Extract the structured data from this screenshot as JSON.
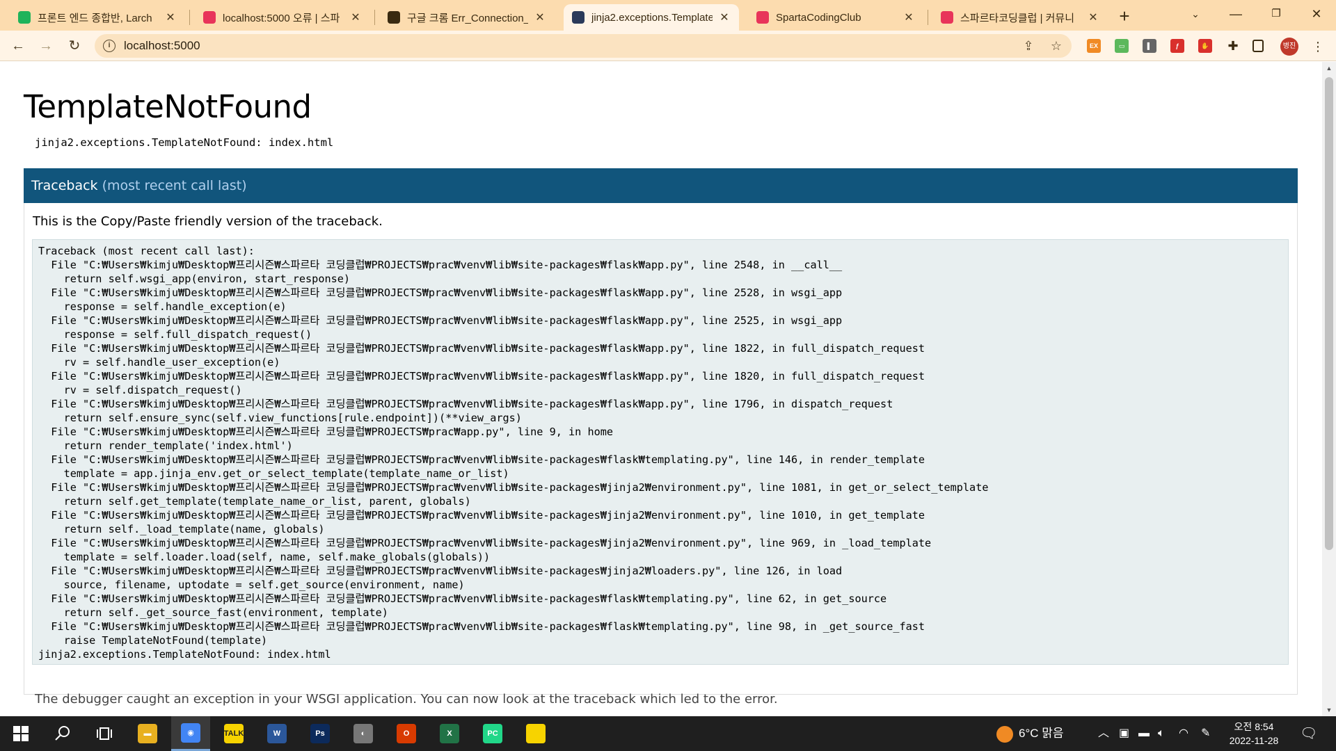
{
  "browser": {
    "tabs": [
      {
        "title": "프론트 엔드 종합반, Larch",
        "favicon": "blog-icon",
        "color": "#1fb35a"
      },
      {
        "title": "localhost:5000 오류 | 스파",
        "favicon": "sparta-heart-icon",
        "color": "#e8345a"
      },
      {
        "title": "구글 크롬 Err_Connection_",
        "favicon": "dots-icon",
        "color": "#3a2a10"
      },
      {
        "title": "jinja2.exceptions.Template",
        "favicon": "terminal-icon",
        "color": "#2a3a5a"
      },
      {
        "title": "SpartaCodingClub",
        "favicon": "sparta-shield-icon",
        "color": "#e8345a"
      },
      {
        "title": "스파르타코딩클럽 | 커뮤니",
        "favicon": "sparta-heart-icon",
        "color": "#e8345a"
      }
    ],
    "active_tab": 3,
    "url": "localhost:5000",
    "avatar_label": "병진",
    "extensions": [
      {
        "name": "ex-extension-icon",
        "label": "EX",
        "color": "#f08a24"
      },
      {
        "name": "screen-extension-icon",
        "label": "▭",
        "color": "#5cb85c"
      },
      {
        "name": "bar-extension-icon",
        "label": "▌",
        "color": "#666666"
      },
      {
        "name": "pdf-extension-icon",
        "label": "ƒ",
        "color": "#d9302c"
      },
      {
        "name": "adblock-extension-icon",
        "label": "✋",
        "color": "#d9302c"
      }
    ]
  },
  "page": {
    "exception_title": "TemplateNotFound",
    "exception_message": "jinja2.exceptions.TemplateNotFound: index.html",
    "traceback_header": "Traceback",
    "traceback_sub": "(most recent call last)",
    "copy_paste_note": "This is the Copy/Paste friendly version of the traceback.",
    "traceback_text": "Traceback (most recent call last):\n  File \"C:₩Users₩kimju₩Desktop₩프리시즌₩스파르타 코딩클럽₩PROJECTS₩prac₩venv₩lib₩site-packages₩flask₩app.py\", line 2548, in __call__\n    return self.wsgi_app(environ, start_response)\n  File \"C:₩Users₩kimju₩Desktop₩프리시즌₩스파르타 코딩클럽₩PROJECTS₩prac₩venv₩lib₩site-packages₩flask₩app.py\", line 2528, in wsgi_app\n    response = self.handle_exception(e)\n  File \"C:₩Users₩kimju₩Desktop₩프리시즌₩스파르타 코딩클럽₩PROJECTS₩prac₩venv₩lib₩site-packages₩flask₩app.py\", line 2525, in wsgi_app\n    response = self.full_dispatch_request()\n  File \"C:₩Users₩kimju₩Desktop₩프리시즌₩스파르타 코딩클럽₩PROJECTS₩prac₩venv₩lib₩site-packages₩flask₩app.py\", line 1822, in full_dispatch_request\n    rv = self.handle_user_exception(e)\n  File \"C:₩Users₩kimju₩Desktop₩프리시즌₩스파르타 코딩클럽₩PROJECTS₩prac₩venv₩lib₩site-packages₩flask₩app.py\", line 1820, in full_dispatch_request\n    rv = self.dispatch_request()\n  File \"C:₩Users₩kimju₩Desktop₩프리시즌₩스파르타 코딩클럽₩PROJECTS₩prac₩venv₩lib₩site-packages₩flask₩app.py\", line 1796, in dispatch_request\n    return self.ensure_sync(self.view_functions[rule.endpoint])(**view_args)\n  File \"C:₩Users₩kimju₩Desktop₩프리시즌₩스파르타 코딩클럽₩PROJECTS₩prac₩app.py\", line 9, in home\n    return render_template('index.html')\n  File \"C:₩Users₩kimju₩Desktop₩프리시즌₩스파르타 코딩클럽₩PROJECTS₩prac₩venv₩lib₩site-packages₩flask₩templating.py\", line 146, in render_template\n    template = app.jinja_env.get_or_select_template(template_name_or_list)\n  File \"C:₩Users₩kimju₩Desktop₩프리시즌₩스파르타 코딩클럽₩PROJECTS₩prac₩venv₩lib₩site-packages₩jinja2₩environment.py\", line 1081, in get_or_select_template\n    return self.get_template(template_name_or_list, parent, globals)\n  File \"C:₩Users₩kimju₩Desktop₩프리시즌₩스파르타 코딩클럽₩PROJECTS₩prac₩venv₩lib₩site-packages₩jinja2₩environment.py\", line 1010, in get_template\n    return self._load_template(name, globals)\n  File \"C:₩Users₩kimju₩Desktop₩프리시즌₩스파르타 코딩클럽₩PROJECTS₩prac₩venv₩lib₩site-packages₩jinja2₩environment.py\", line 969, in _load_template\n    template = self.loader.load(self, name, self.make_globals(globals))\n  File \"C:₩Users₩kimju₩Desktop₩프리시즌₩스파르타 코딩클럽₩PROJECTS₩prac₩venv₩lib₩site-packages₩jinja2₩loaders.py\", line 126, in load\n    source, filename, uptodate = self.get_source(environment, name)\n  File \"C:₩Users₩kimju₩Desktop₩프리시즌₩스파르타 코딩클럽₩PROJECTS₩prac₩venv₩lib₩site-packages₩flask₩templating.py\", line 62, in get_source\n    return self._get_source_fast(environment, template)\n  File \"C:₩Users₩kimju₩Desktop₩프리시즌₩스파르타 코딩클럽₩PROJECTS₩prac₩venv₩lib₩site-packages₩flask₩templating.py\", line 98, in _get_source_fast\n    raise TemplateNotFound(template)\njinja2.exceptions.TemplateNotFound: index.html",
    "footer_text": "The debugger caught an exception in your WSGI application. You can now look at the traceback which led to the error."
  },
  "taskbar": {
    "apps": [
      {
        "name": "file-explorer-icon",
        "label": "▬",
        "color": "#e8b020"
      },
      {
        "name": "chrome-icon",
        "label": "◉",
        "color": "#4285f4"
      },
      {
        "name": "kakaotalk-icon",
        "label": "TALK",
        "color": "#f7d300"
      },
      {
        "name": "word-icon",
        "label": "W",
        "color": "#2b579a"
      },
      {
        "name": "photoshop-icon",
        "label": "Ps",
        "color": "#0c2a5b"
      },
      {
        "name": "game-icon",
        "label": "◐",
        "color": "#777777"
      },
      {
        "name": "office-icon",
        "label": "O",
        "color": "#d83b01"
      },
      {
        "name": "excel-icon",
        "label": "X",
        "color": "#217346"
      },
      {
        "name": "pycharm-icon",
        "label": "PC",
        "color": "#21d789"
      },
      {
        "name": "sticky-notes-icon",
        "label": "",
        "color": "#f7d300"
      }
    ],
    "active_app": 1,
    "weather": "6°C  맑음",
    "time": "오전 8:54",
    "date": "2022-11-28",
    "colors": {
      "taskbar": "#1f1f1f",
      "accent": "#11557c"
    }
  }
}
